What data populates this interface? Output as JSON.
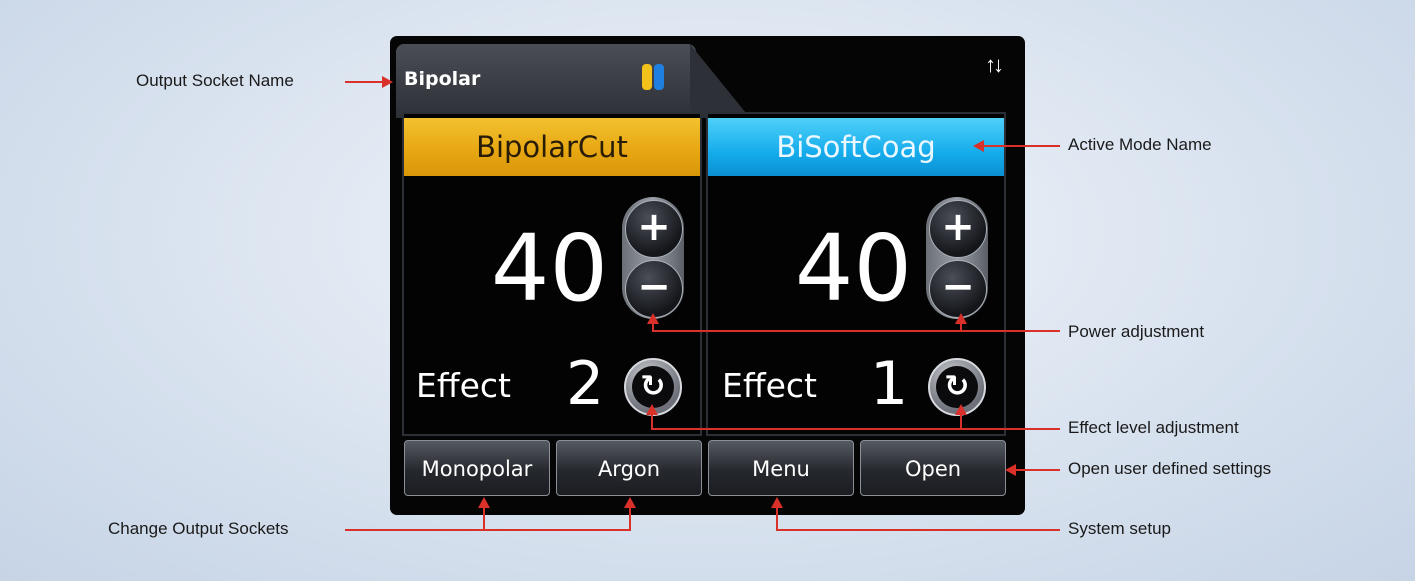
{
  "screen": {
    "socket_name": "Bipolar",
    "socket_icon_colors": [
      "#f2c21b",
      "#1f7fe0"
    ],
    "sort_icon": "sort-arrows-icon",
    "channels": [
      {
        "mode": "BipolarCut",
        "mode_color": "#f2b21d",
        "power": "40",
        "effect_label": "Effect",
        "effect": "2"
      },
      {
        "mode": "BiSoftCoag",
        "mode_color": "#1cb4f0",
        "power": "40",
        "effect_label": "Effect",
        "effect": "1"
      }
    ],
    "buttons": [
      "Monopolar",
      "Argon",
      "Menu",
      "Open"
    ]
  },
  "callouts": {
    "output_socket_name": "Output Socket Name",
    "active_mode_name": "Active Mode Name",
    "power_adjustment": "Power adjustment",
    "effect_level_adjustment": "Effect level adjustment",
    "open_user_defined_settings": "Open user defined settings",
    "change_output_sockets": "Change Output Sockets",
    "system_setup": "System setup"
  },
  "accent_color": "#d9302a"
}
